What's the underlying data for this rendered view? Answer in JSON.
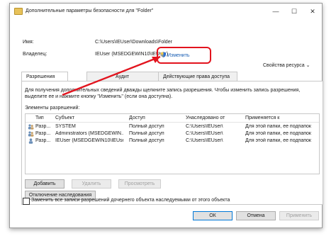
{
  "window": {
    "title": "Дополнительные параметры безопасности для \"Folder\"",
    "minimize_glyph": "—",
    "maximize_glyph": "☐",
    "close_glyph": "✕"
  },
  "fields": {
    "name_label": "Имя:",
    "name_value": "C:\\Users\\IEUser\\Downloads\\Folder",
    "owner_label": "Владелец:",
    "owner_value": "IEUser (MSEDGEWIN10\\IEUser)",
    "change_link": "Изменить"
  },
  "resource_properties": "Свойства ресурса",
  "tabs": [
    {
      "label": "Разрешения"
    },
    {
      "label": "Аудит"
    },
    {
      "label": "Действующие права доступа"
    }
  ],
  "info_text": "Для получения дополнительных сведений дважды щелкните запись разрешения. Чтобы изменить запись разрешения, выделите ее и нажмите кнопку \"Изменить\" (если она доступна).",
  "permissions_title": "Элементы разрешений:",
  "table": {
    "headers": [
      "Тип",
      "Субъект",
      "Доступ",
      "Унаследовано от",
      "Применяется к"
    ],
    "rows": [
      [
        "Разр...",
        "SYSTEM",
        "Полный доступ",
        "C:\\Users\\IEUser\\",
        "Для этой папки, ее подпапок"
      ],
      [
        "Разр...",
        "Administrators (MSEDGEWIN...",
        "Полный доступ",
        "C:\\Users\\IEUser\\",
        "Для этой папки, ее подпапок"
      ],
      [
        "Разр...",
        "IEUser (MSEDGEWIN10\\IEUser)",
        "Полный доступ",
        "C:\\Users\\IEUser\\",
        "Для этой папки, ее подпапок"
      ]
    ]
  },
  "buttons": {
    "add": "Добавить",
    "remove": "Удалить",
    "view": "Просмотреть",
    "disable_inheritance": "Отключение наследования",
    "ok": "ОК",
    "cancel": "Отмена",
    "apply": "Применить"
  },
  "replace_checkbox_label": "Заменить все записи разрешений дочернего объекта наследуемыми от этого объекта",
  "colors": {
    "highlight": "#e2141e",
    "link": "#1a5fb4"
  }
}
